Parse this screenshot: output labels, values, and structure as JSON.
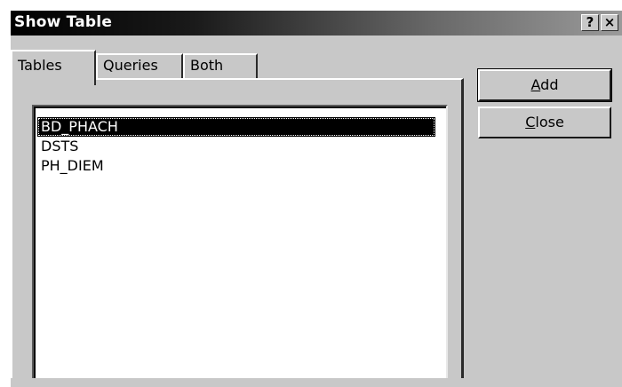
{
  "window": {
    "title": "Show Table",
    "help_label": "?",
    "close_label": "×"
  },
  "tabs": [
    {
      "label": "Tables",
      "active": true
    },
    {
      "label": "Queries",
      "active": false
    },
    {
      "label": "Both",
      "active": false
    }
  ],
  "list": {
    "items": [
      {
        "label": "BD_PHACH",
        "selected": true
      },
      {
        "label": "DSTS",
        "selected": false
      },
      {
        "label": "PH_DIEM",
        "selected": false
      }
    ]
  },
  "buttons": {
    "add": {
      "mnemonic": "A",
      "rest": "dd"
    },
    "close": {
      "mnemonic": "C",
      "rest": "lose"
    }
  }
}
